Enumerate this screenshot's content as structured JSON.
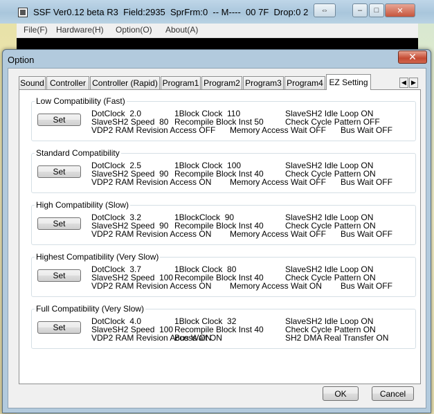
{
  "app": {
    "title": "SSF Ver0.12 beta R3  Field:2935  SprFrm:0  -- M----  00 7F  Drop:0 2",
    "menu": [
      "File(F)",
      "Hardware(H)",
      "Option(O)",
      "About(A)"
    ],
    "swap_symbol": "⇔"
  },
  "dialog": {
    "title": "Option",
    "close_symbol": "✕",
    "tabs": [
      "Sound",
      "Controller",
      "Controller (Rapid)",
      "Program1",
      "Program2",
      "Program3",
      "Program4",
      "EZ Setting"
    ],
    "active_tab": "EZ Setting",
    "set_label": "Set",
    "groups": [
      {
        "title": "Low Compatibility (Fast)",
        "r1": [
          "DotClock  2.0",
          "1Block Clock  110",
          "SlaveSH2 Idle Loop ON"
        ],
        "r2": [
          "SlaveSH2 Speed  80",
          "Recompile Block Inst 50",
          "Check Cycle Pattern OFF"
        ],
        "r3": [
          "VDP2 RAM Revision Access OFF",
          "Memory Access Wait OFF",
          "Bus Wait OFF"
        ]
      },
      {
        "title": "Standard Compatibility",
        "r1": [
          "DotClock  2.5",
          "1Block Clock  100",
          "SlaveSH2 Idle Loop ON"
        ],
        "r2": [
          "SlaveSH2 Speed  90",
          "Recompile Block Inst 40",
          "Check Cycle Pattern ON"
        ],
        "r3": [
          "VDP2 RAM Revision Access ON",
          "Memory Access Wait OFF",
          "Bus Wait OFF"
        ]
      },
      {
        "title": "High Compatibility (Slow)",
        "r1": [
          "DotClock  3.2",
          "1BlockClock  90",
          "SlaveSH2 Idle Loop ON"
        ],
        "r2": [
          "SlaveSH2 Speed  90",
          "Recompile Block Inst 40",
          "Check Cycle Pattern ON"
        ],
        "r3": [
          "VDP2 RAM Revision Access ON",
          "Memory Access Wait OFF",
          "Bus Wait OFF"
        ]
      },
      {
        "title": "Highest Compatibility (Very Slow)",
        "r1": [
          "DotClock  3.7",
          "1Block Clock  80",
          "SlaveSH2 Idle Loop ON"
        ],
        "r2": [
          "SlaveSH2 Speed  100",
          "Recompile Block Inst 40",
          "Check Cycle Pattern ON"
        ],
        "r3": [
          "VDP2 RAM Revision Access ON",
          "Memory Access Wait ON",
          "Bus Wait OFF"
        ]
      },
      {
        "title": "Full Compatibility (Very Slow)",
        "r1": [
          "DotClock  4.0",
          "1Block Clock  32",
          "SlaveSH2 Idle Loop ON"
        ],
        "r2": [
          "SlaveSH2 Speed  100",
          "Recompile Block Inst 40",
          "Check Cycle Pattern ON"
        ],
        "r3": [
          "VDP2 RAM Revision Access ON",
          "Bus Wait ON",
          "SH2 DMA Real Transfer ON"
        ]
      }
    ],
    "ok_label": "OK",
    "cancel_label": "Cancel"
  }
}
